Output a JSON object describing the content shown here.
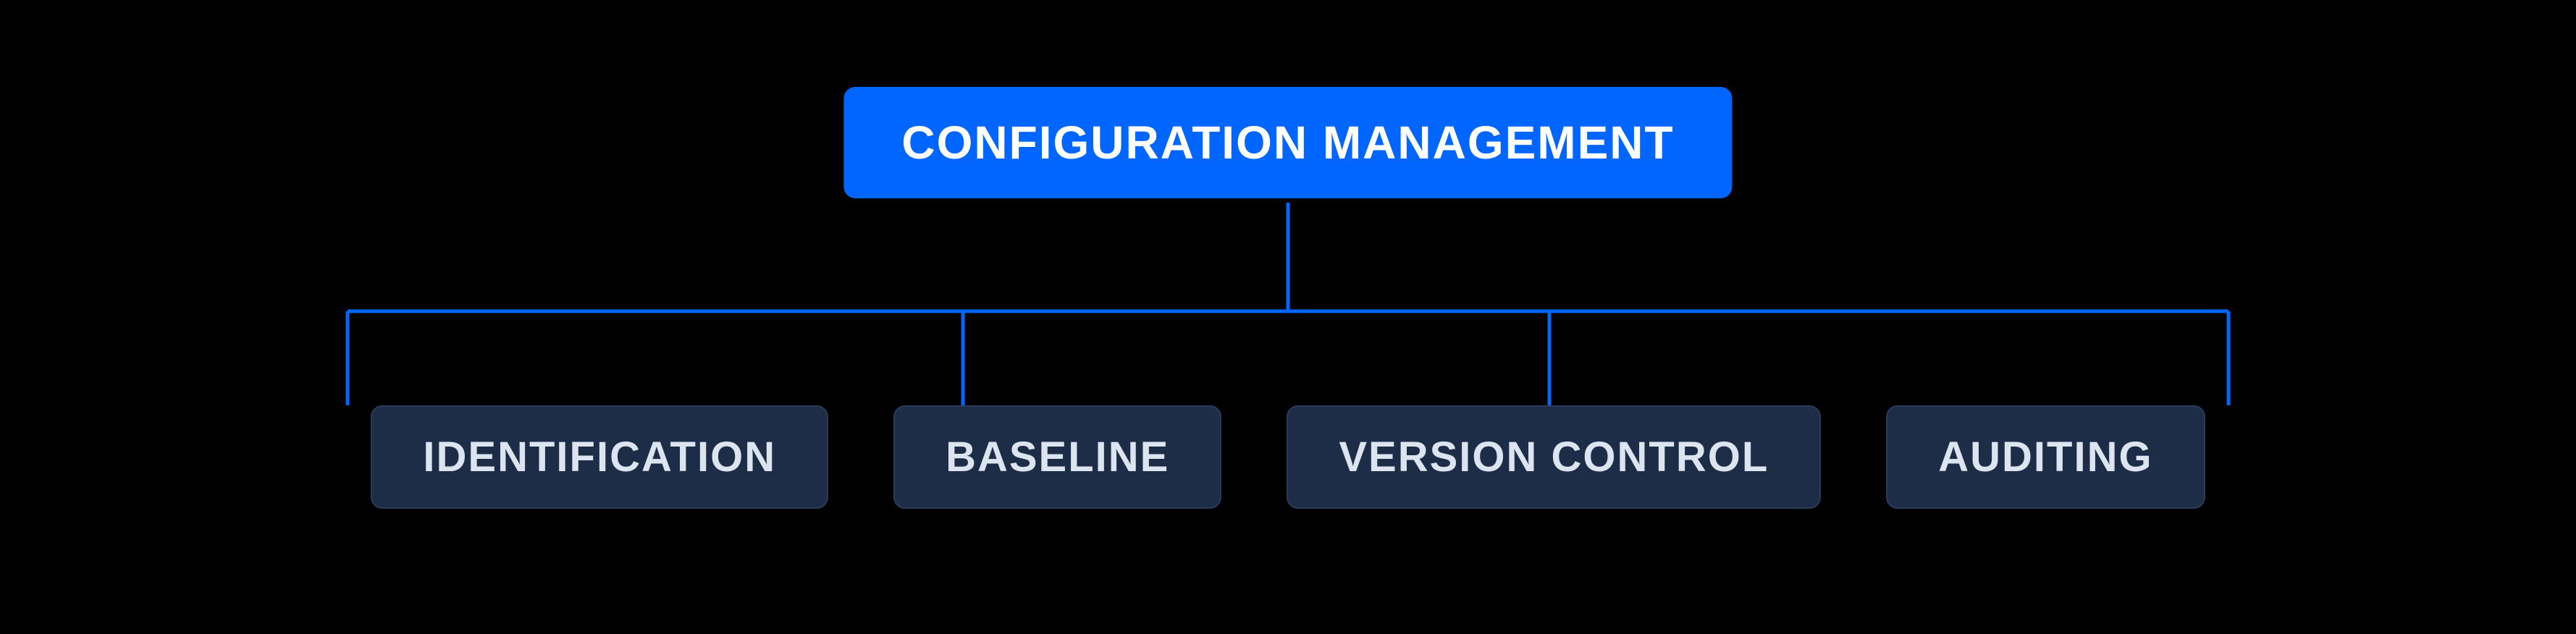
{
  "diagram": {
    "root": {
      "label": "CONFIGURATION MANAGEMENT"
    },
    "children": [
      {
        "label": "IDENTIFICATION"
      },
      {
        "label": "BASELINE"
      },
      {
        "label": "VERSION CONTROL"
      },
      {
        "label": "AUDITING"
      }
    ]
  },
  "colors": {
    "root_bg": "#0066FF",
    "root_text": "#FFFFFF",
    "child_bg": "#1E2D47",
    "child_text": "#DCE4F0",
    "connector": "#0066FF",
    "background": "#000000"
  }
}
